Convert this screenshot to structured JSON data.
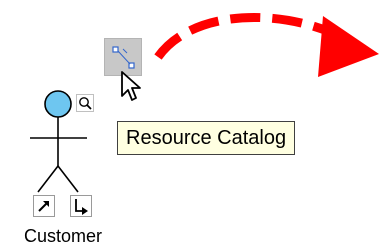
{
  "tooltip": {
    "text": "Resource Catalog"
  },
  "actor": {
    "label": "Customer"
  },
  "icons": {
    "catalog_button": "resource-catalog-icon",
    "cursor": "mouse-pointer-icon",
    "drag_arrow": "dashed-curved-arrow-icon",
    "magnifier": "magnifier-icon",
    "association": "association-arrow-icon",
    "generalization": "generalization-arrow-icon"
  },
  "colors": {
    "arrow": "#ff0000",
    "actor_head": "#6ec6f0",
    "tooltip_bg": "#ffffe1",
    "catalog_bg": "#c8c8c8"
  }
}
